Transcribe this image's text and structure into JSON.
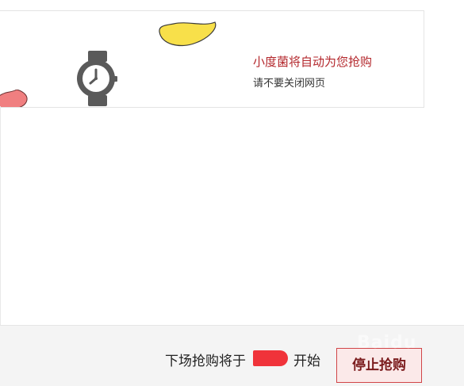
{
  "banner": {
    "title": "小度菌将自动为您抢购",
    "subtitle": "请不要关闭网页",
    "title_color": "#b3262b"
  },
  "icons": {
    "watch": "wristwatch-icon",
    "yellow_shape": "yellow-blob-decoration",
    "pink_shape": "pink-blob-decoration"
  },
  "footer": {
    "countdown_prefix": "下场抢购将于",
    "countdown_suffix": "开始",
    "stop_button_label": "停止抢购",
    "accent_color": "#d14548",
    "redaction_color": "#f0333a"
  },
  "watermark": {
    "text": "Bai du"
  }
}
